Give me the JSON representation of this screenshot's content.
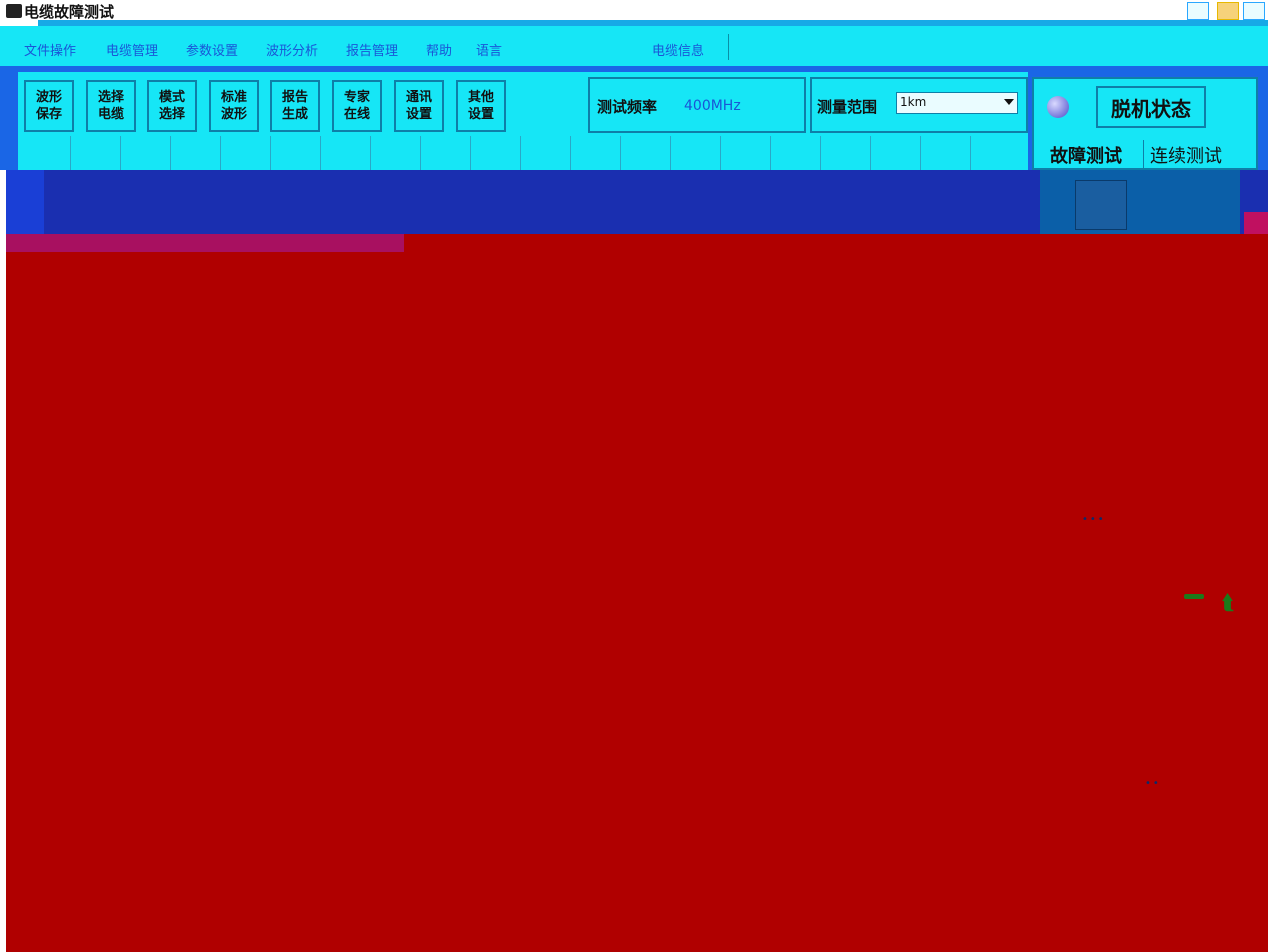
{
  "window": {
    "title": "电缆故障测试",
    "icon": "app-icon"
  },
  "menu": {
    "items": [
      "文件操作",
      "电缆管理",
      "参数设置",
      "波形分析",
      "报告管理",
      "帮助",
      "语言"
    ],
    "cable_info_label": "电缆信息"
  },
  "toolbar": {
    "buttons": [
      {
        "label": "波形\n保存"
      },
      {
        "label": "选择\n电缆"
      },
      {
        "label": "模式\n选择"
      },
      {
        "label": "标准\n波形"
      },
      {
        "label": "报告\n生成"
      },
      {
        "label": "专家\n在线"
      },
      {
        "label": "通讯\n设置"
      },
      {
        "label": "其他\n设置"
      }
    ]
  },
  "test_params": {
    "frequency_label": "测试频率",
    "frequency_value": "400MHz",
    "range_label": "测量范围",
    "range_value": "1km"
  },
  "status": {
    "offline_label": "脱机状态",
    "led_color": "#4a4ac8",
    "tab_fault": "故障测试",
    "tab_continuous": "连续测试"
  },
  "colors": {
    "panel": "#16e6f6",
    "band": "#1a2fb0",
    "waveform_bg": "#b00000",
    "marker": "#1a7a1a"
  },
  "waveform": {
    "cursor_dots_1": "•••",
    "cursor_dots_2": "••",
    "marker_arrow": "⮬"
  }
}
